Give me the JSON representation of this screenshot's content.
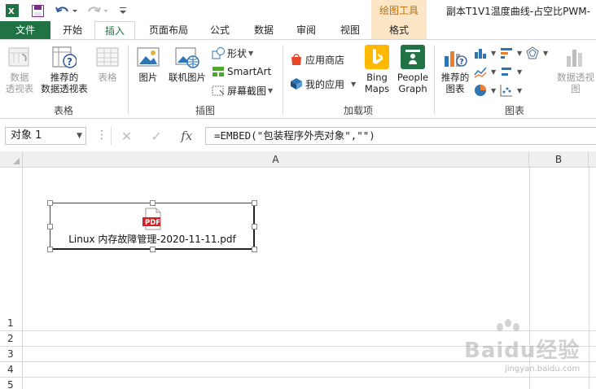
{
  "window": {
    "title": "副本T1V1温度曲线-占空比PWM-",
    "context_tools": "绘图工具"
  },
  "qat": {
    "excel_icon": "excel-logo-icon",
    "save_icon": "save-icon",
    "undo_icon": "undo-icon",
    "redo_icon": "redo-icon",
    "customize_icon": "customize-qat-icon"
  },
  "tabs": [
    "文件",
    "开始",
    "插入",
    "页面布局",
    "公式",
    "数据",
    "审阅",
    "视图",
    "格式"
  ],
  "ribbon": {
    "tables": {
      "label": "表格",
      "pivot": "数据\n透视表",
      "recommended_pivot": "推荐的\n数据透视表",
      "table": "表格"
    },
    "illustrations": {
      "label": "插图",
      "pictures": "图片",
      "online_pictures": "联机图片",
      "shapes": "形状",
      "smartart": "SmartArt",
      "screenshot": "屏幕截图"
    },
    "addins": {
      "label": "加载项",
      "store": "应用商店",
      "my_apps": "我的应用",
      "bing_maps": "Bing\nMaps",
      "people_graph": "People\nGraph"
    },
    "charts": {
      "label": "图表",
      "recommended": "推荐的\n图表",
      "pivot_chart": "数据透视图"
    }
  },
  "formula_bar": {
    "name_box": "对象 1",
    "formula": "=EMBED(\"包装程序外壳对象\",\"\")",
    "fx": "fx"
  },
  "sheet": {
    "columns": [
      "A",
      "B"
    ],
    "rows": [
      "1",
      "2",
      "3",
      "4",
      "5"
    ]
  },
  "embedded_object": {
    "icon_label": "PDF",
    "file_name": "Linux 内存故障管理-2020-11-11.pdf"
  },
  "watermark": {
    "text": "Baidu经验",
    "url": "jingyan.baidu.com"
  },
  "colors": {
    "excel_green": "#217346",
    "context_orange": "#c36d00",
    "pdf_red": "#d62027"
  }
}
